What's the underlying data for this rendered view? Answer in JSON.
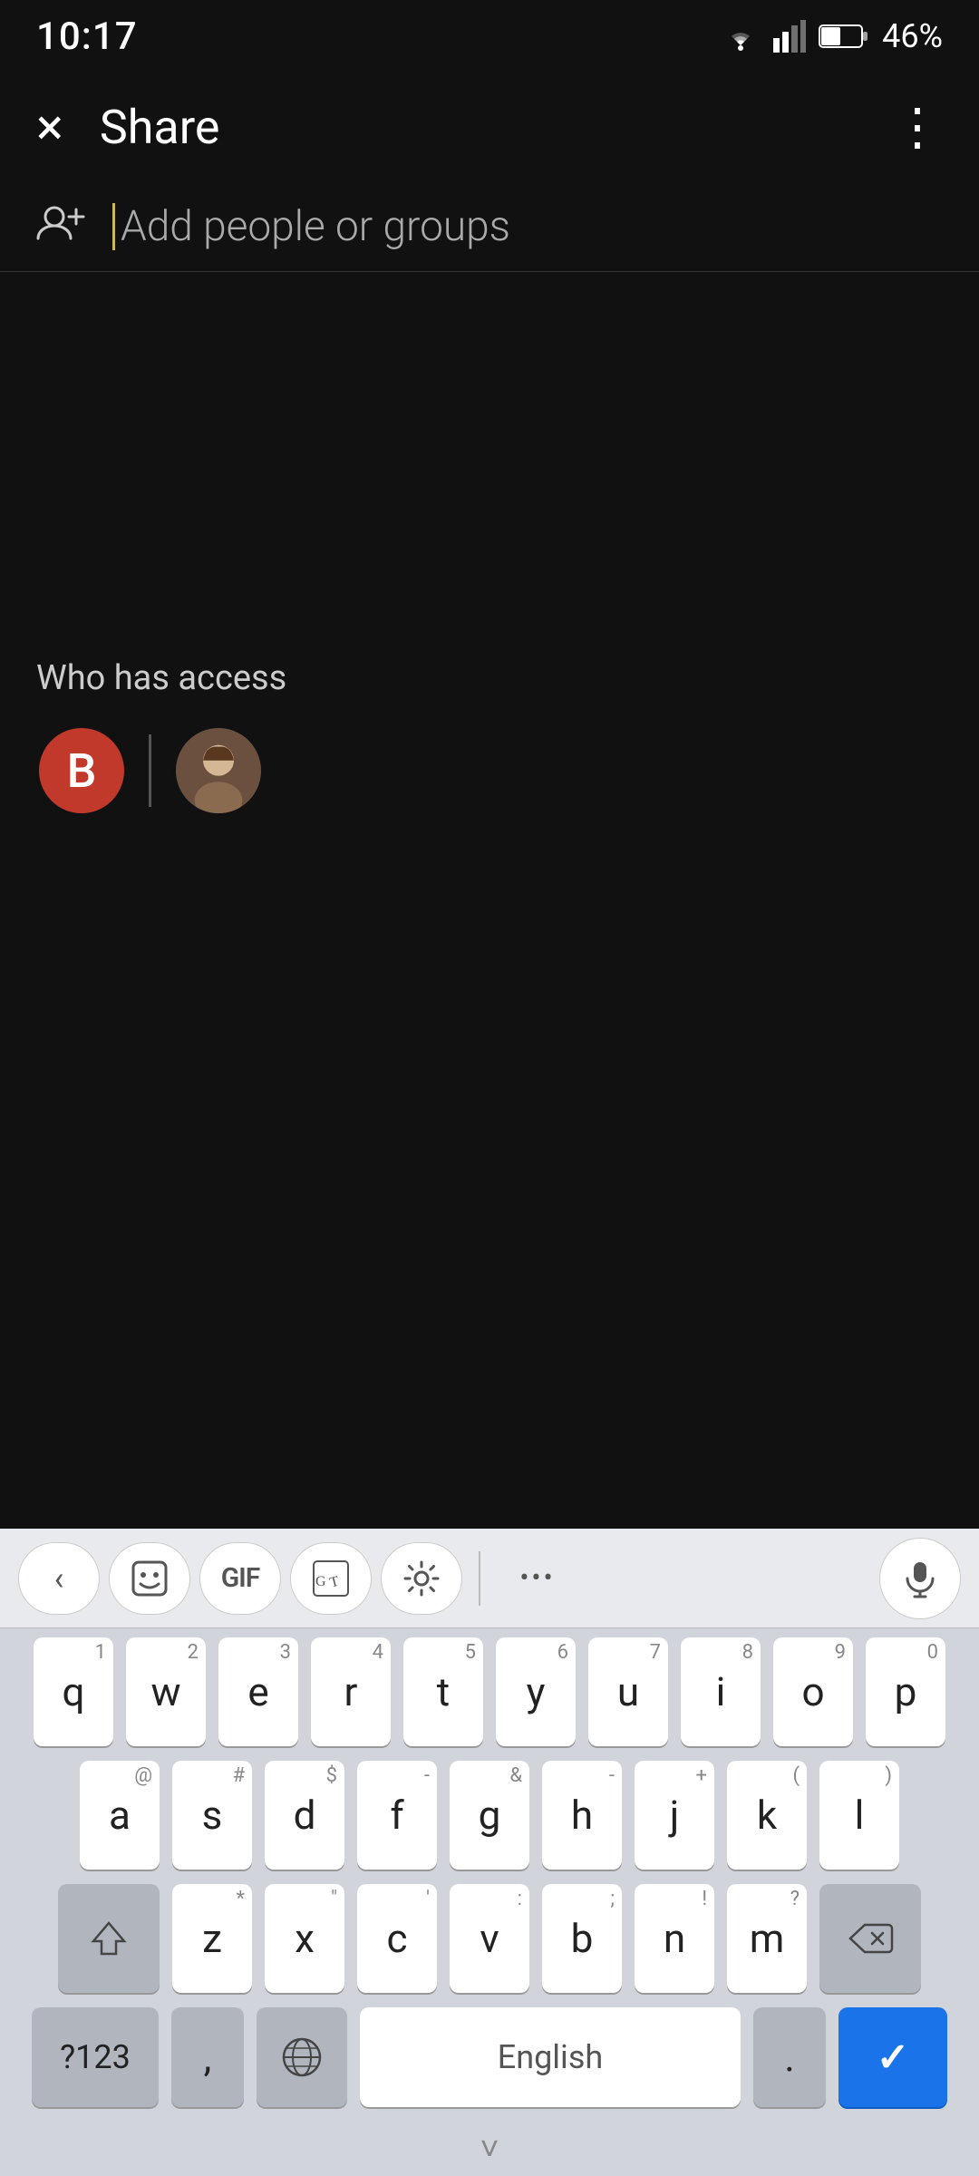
{
  "statusBar": {
    "time": "10:17",
    "batteryPercent": "46%",
    "wifiStrength": "full",
    "signalStrength": "medium"
  },
  "header": {
    "title": "Share",
    "closeLabel": "×",
    "menuLabel": "⋮"
  },
  "searchRow": {
    "placeholder": "Add people or groups"
  },
  "accessSection": {
    "label": "Who has access",
    "avatar1Letter": "B",
    "avatar2Type": "photo"
  },
  "keyboardToolbar": {
    "backLabel": "<",
    "gifLabel": "GIF",
    "dotsLabel": "...",
    "micLabel": "🎤"
  },
  "keyboardRows": {
    "row1": [
      {
        "key": "q",
        "super": "1"
      },
      {
        "key": "w",
        "super": "2"
      },
      {
        "key": "e",
        "super": "3"
      },
      {
        "key": "r",
        "super": "4"
      },
      {
        "key": "t",
        "super": "5"
      },
      {
        "key": "y",
        "super": "6"
      },
      {
        "key": "u",
        "super": "7"
      },
      {
        "key": "i",
        "super": "8"
      },
      {
        "key": "o",
        "super": "9"
      },
      {
        "key": "p",
        "super": "0"
      }
    ],
    "row2": [
      {
        "key": "a",
        "super": "@"
      },
      {
        "key": "s",
        "super": "#"
      },
      {
        "key": "d",
        "super": "$"
      },
      {
        "key": "f",
        "super": "-"
      },
      {
        "key": "g",
        "super": "&"
      },
      {
        "key": "h",
        "super": "-"
      },
      {
        "key": "j",
        "super": "+"
      },
      {
        "key": "k",
        "super": "("
      },
      {
        "key": "l",
        "super": ")"
      }
    ],
    "row3": [
      {
        "key": "z",
        "super": "*"
      },
      {
        "key": "x",
        "super": "\""
      },
      {
        "key": "c",
        "super": "'"
      },
      {
        "key": "v",
        "super": ":"
      },
      {
        "key": "b",
        "super": ";"
      },
      {
        "key": "n",
        "super": "!"
      },
      {
        "key": "m",
        "super": "?"
      }
    ]
  },
  "keyboardBottom": {
    "numLabel": "?123",
    "commaLabel": ",",
    "spaceLabel": "English",
    "periodLabel": ".",
    "enterCheckmark": "✓"
  }
}
